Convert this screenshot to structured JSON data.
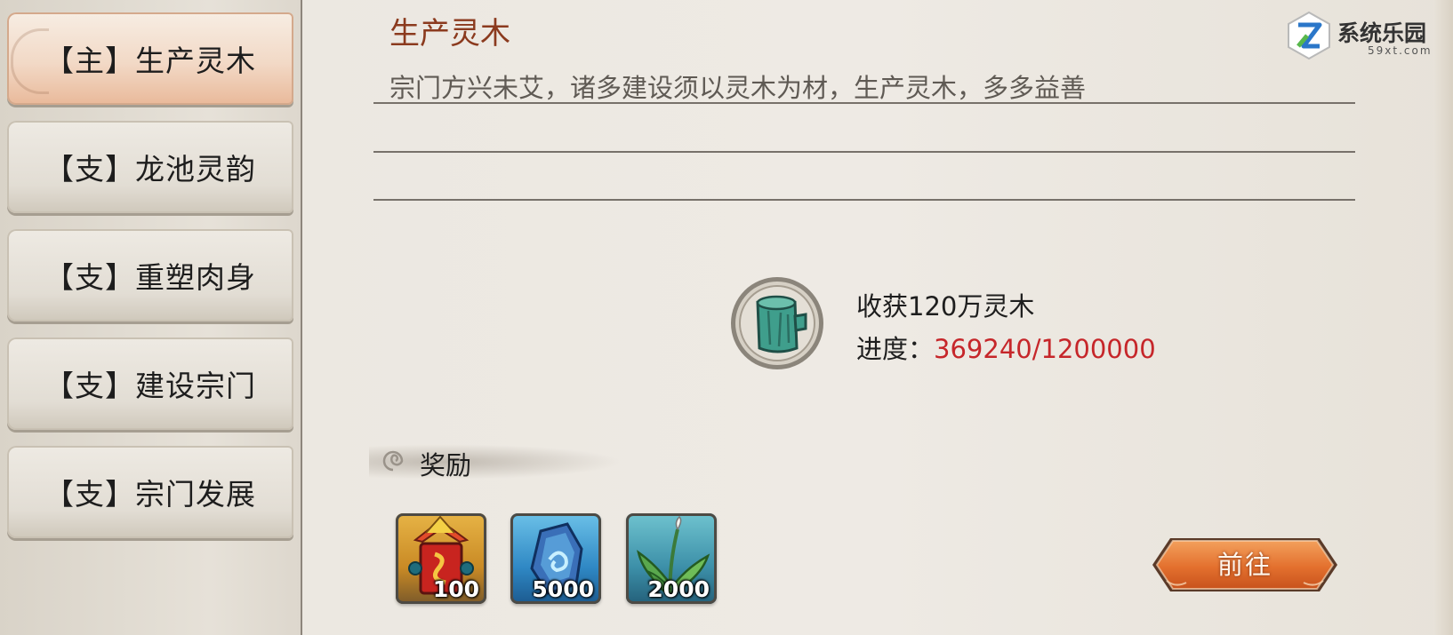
{
  "quest_tabs": [
    {
      "label": "【主】生产灵木",
      "active": true
    },
    {
      "label": "【支】龙池灵韵",
      "active": false
    },
    {
      "label": "【支】重塑肉身",
      "active": false
    },
    {
      "label": "【支】建设宗门",
      "active": false
    },
    {
      "label": "【支】宗门发展",
      "active": false
    }
  ],
  "quest": {
    "title": "生产灵木",
    "description": "宗门方兴未艾，诸多建设须以灵木为材，生产灵木，多多益善"
  },
  "goal": {
    "icon": "spirit-wood-log-icon",
    "text": "收获120万灵木",
    "progress_label": "进度：",
    "progress_value": "369240/1200000",
    "progress_current": 369240,
    "progress_target": 1200000
  },
  "rewards": {
    "label": "奖励",
    "items": [
      {
        "icon": "sect-banner-token-icon",
        "quantity": "100"
      },
      {
        "icon": "blue-spirit-stone-icon",
        "quantity": "5000"
      },
      {
        "icon": "spirit-herb-icon",
        "quantity": "2000"
      }
    ]
  },
  "actions": {
    "goto_label": "前往"
  },
  "watermark": {
    "text": "系统乐园",
    "subtext": "59xt.com"
  },
  "colors": {
    "title": "#8b3a1e",
    "progress_value": "#c6262a",
    "button_orange": "#e3702e",
    "active_tab": "#f0cdb5"
  }
}
